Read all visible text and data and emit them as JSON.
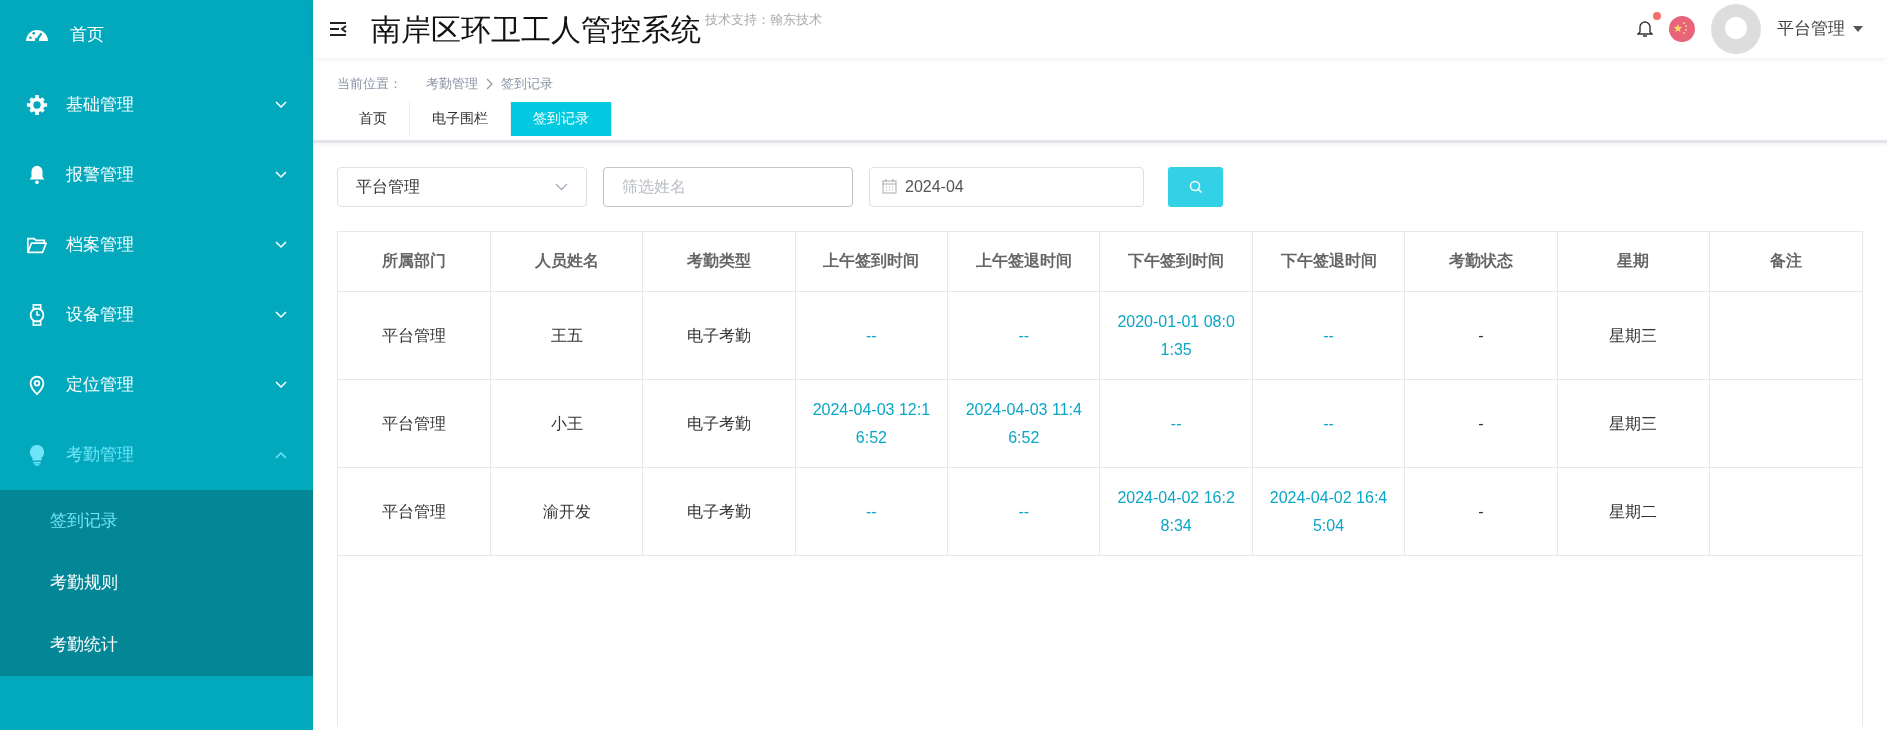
{
  "sidebar": {
    "items": [
      {
        "label": "首页",
        "selected": false
      },
      {
        "label": "基础管理",
        "expanded": false,
        "selected": false
      },
      {
        "label": "报警管理",
        "expanded": false,
        "selected": false
      },
      {
        "label": "档案管理",
        "expanded": false,
        "selected": false
      },
      {
        "label": "设备管理",
        "expanded": false,
        "selected": false
      },
      {
        "label": "定位管理",
        "expanded": false,
        "selected": false
      },
      {
        "label": "考勤管理",
        "expanded": true,
        "selected": true,
        "children": [
          {
            "label": "签到记录",
            "selected": true
          },
          {
            "label": "考勤规则",
            "selected": false
          },
          {
            "label": "考勤统计",
            "selected": false
          }
        ]
      }
    ]
  },
  "header": {
    "title": "南岸区环卫工人管控系统",
    "support": "技术支持：翰东技术",
    "unread_notifications": true,
    "user": "平台管理"
  },
  "breadcrumb": {
    "label": "当前位置：",
    "items": [
      "考勤管理",
      "签到记录"
    ]
  },
  "tabs": [
    {
      "label": "首页",
      "selected": false
    },
    {
      "label": "电子围栏",
      "selected": false
    },
    {
      "label": "签到记录",
      "selected": true
    }
  ],
  "filters": {
    "department": "平台管理",
    "name": {
      "placeholder": "筛选姓名"
    },
    "month": "2024-04"
  },
  "table": {
    "columns": [
      {
        "label": "所属部门",
        "kind": "text"
      },
      {
        "label": "人员姓名",
        "kind": "text"
      },
      {
        "label": "考勤类型",
        "kind": "text"
      },
      {
        "label": "上午签到时间",
        "kind": "time"
      },
      {
        "label": "上午签退时间",
        "kind": "time"
      },
      {
        "label": "下午签到时间",
        "kind": "time"
      },
      {
        "label": "下午签退时间",
        "kind": "time"
      },
      {
        "label": "考勤状态",
        "kind": "text"
      },
      {
        "label": "星期",
        "kind": "text"
      },
      {
        "label": "备注",
        "kind": "text"
      }
    ],
    "rows": [
      [
        "平台管理",
        "王五",
        "电子考勤",
        "--",
        "--",
        "2020-01-01 08:01:35",
        "--",
        "-",
        "星期三",
        ""
      ],
      [
        "平台管理",
        "小王",
        "电子考勤",
        "2024-04-03 12:16:52",
        "2024-04-03 11:46:52",
        "--",
        "--",
        "-",
        "星期三",
        ""
      ],
      [
        "平台管理",
        "渝开发",
        "电子考勤",
        "--",
        "--",
        "2024-04-02 16:28:34",
        "2024-04-02 16:45:04",
        "-",
        "星期二",
        ""
      ]
    ]
  }
}
